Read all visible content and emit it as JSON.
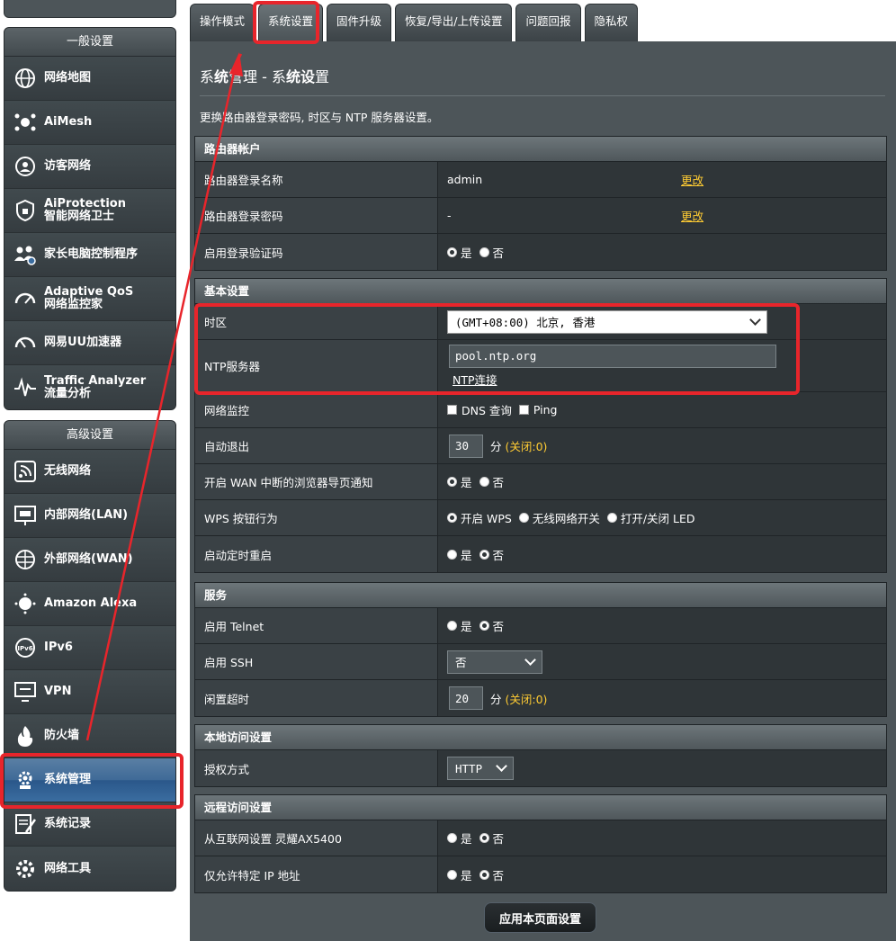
{
  "sidebar": {
    "general_title": "一般设置",
    "general_items": [
      {
        "label": "网络地图",
        "icon": "globe-icon"
      },
      {
        "label": "AiMesh",
        "icon": "mesh-icon"
      },
      {
        "label": "访客网络",
        "icon": "guest-network-icon"
      },
      {
        "label": "AiProtection\n智能网络卫士",
        "icon": "shield-icon"
      },
      {
        "label": "家长电脑控制程序",
        "icon": "parental-control-icon"
      },
      {
        "label": "Adaptive QoS\n网络监控家",
        "icon": "gauge-icon"
      },
      {
        "label": "网易UU加速器",
        "icon": "speedometer-icon"
      },
      {
        "label": "Traffic Analyzer\n流量分析",
        "icon": "analyzer-icon"
      }
    ],
    "advanced_title": "高级设置",
    "advanced_items": [
      {
        "label": "无线网络",
        "icon": "wireless-icon"
      },
      {
        "label": "内部网络(LAN)",
        "icon": "lan-icon"
      },
      {
        "label": "外部网络(WAN)",
        "icon": "wan-globe-icon"
      },
      {
        "label": "Amazon Alexa",
        "icon": "alexa-icon"
      },
      {
        "label": "IPv6",
        "icon": "ipv6-icon"
      },
      {
        "label": "VPN",
        "icon": "vpn-icon"
      },
      {
        "label": "防火墙",
        "icon": "firewall-icon"
      },
      {
        "label": "系统管理",
        "icon": "admin-gear-icon",
        "active": true
      },
      {
        "label": "系统记录",
        "icon": "log-icon"
      },
      {
        "label": "网络工具",
        "icon": "tools-gear-icon"
      }
    ]
  },
  "tabs": [
    "操作模式",
    "系统设置",
    "固件升级",
    "恢复/导出/上传设置",
    "问题回报",
    "隐私权"
  ],
  "active_tab": 1,
  "page": {
    "title_a": "系",
    "title_b": "统",
    "title_c": "管理 - 系",
    "title_d": "统设",
    "title_e": "置",
    "description": "更换路由器登录密码, 时区与 NTP 服务器设置。"
  },
  "account": {
    "header": "路由器帐户",
    "username_label": "路由器登录名称",
    "username_value": "admin",
    "change1": "更改",
    "password_label": "路由器登录密码",
    "password_value": "-",
    "change2": "更改",
    "captcha_label": "启用登录验证码",
    "yes": "是",
    "no": "否"
  },
  "basic": {
    "header": "基本设置",
    "timezone_label": "时区",
    "timezone_value": "(GMT+08:00) 北京, 香港",
    "ntp_label": "NTP服务器",
    "ntp_value": "pool.ntp.org",
    "ntp_link": "NTP连接",
    "monitor_label": "网络监控",
    "dns_query": "DNS 查询",
    "ping": "Ping",
    "logout_label": "自动退出",
    "logout_value": "30",
    "minute_unit": "分",
    "off_note": "(关闭:0)",
    "wan_notify_label": "开启 WAN 中断的浏览器导页通知",
    "wps_label": "WPS 按钮行为",
    "wps_opt1": "开启 WPS",
    "wps_opt2": "无线网络开关",
    "wps_opt3": "打开/关闭 LED",
    "reboot_label": "启动定时重启"
  },
  "service": {
    "header": "服务",
    "telnet_label": "启用 Telnet",
    "ssh_label": "启用 SSH",
    "ssh_value": "否",
    "idle_label": "闲置超时",
    "idle_value": "20"
  },
  "local": {
    "header": "本地访问设置",
    "auth_label": "授权方式",
    "auth_value": "HTTP"
  },
  "remote": {
    "header": "远程访问设置",
    "wan_access_label": "从互联网设置 灵耀AX5400",
    "ip_only_label": "仅允许特定 IP 地址"
  },
  "apply_button": "应用本页面设置",
  "annotation_color": "#e8252b"
}
